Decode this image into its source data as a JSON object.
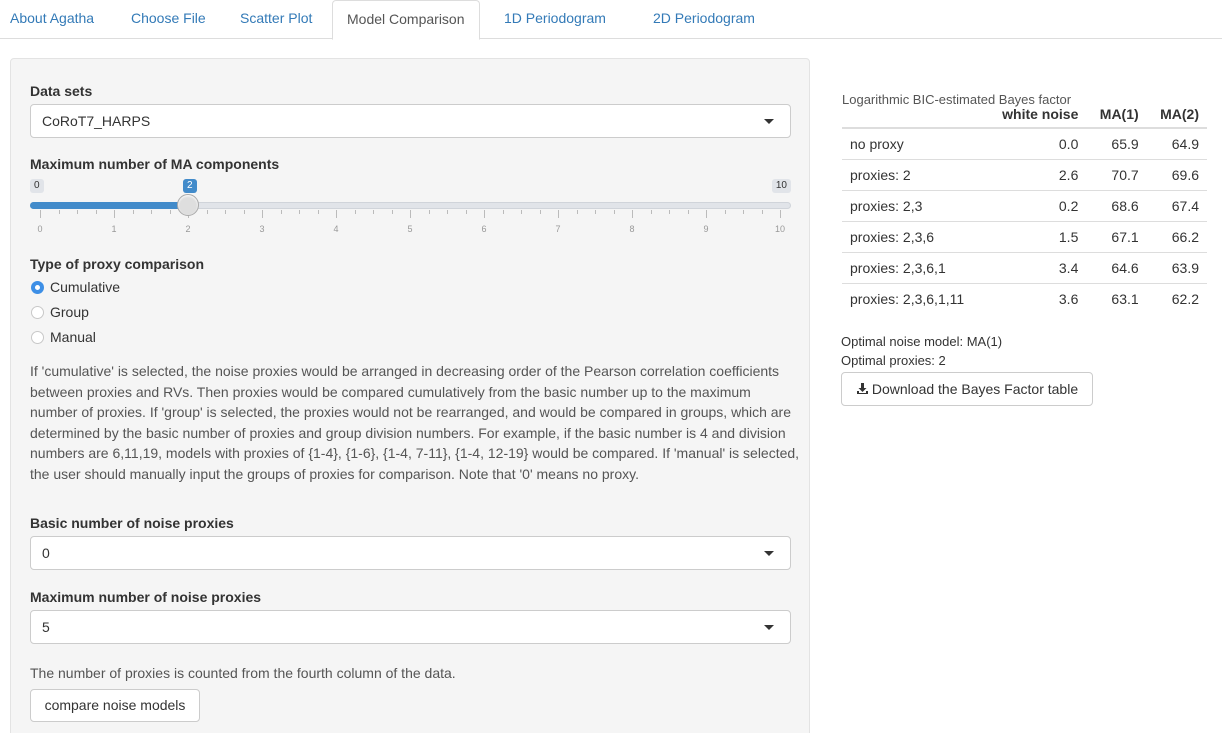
{
  "tabs": [
    "About Agatha",
    "Choose File",
    "Scatter Plot",
    "Model Comparison",
    "1D Periodogram",
    "2D Periodogram"
  ],
  "active_tab": "Model Comparison",
  "datasets": {
    "label": "Data sets",
    "value": "CoRoT7_HARPS"
  },
  "ma_slider": {
    "label": "Maximum number of MA components",
    "min": "0",
    "max": "10",
    "value": "2",
    "value_fraction": 0.2,
    "ticks": [
      "0",
      "1",
      "2",
      "3",
      "4",
      "5",
      "6",
      "7",
      "8",
      "9",
      "10"
    ]
  },
  "proxy_type": {
    "label": "Type of proxy comparison",
    "options": [
      "Cumulative",
      "Group",
      "Manual"
    ],
    "selected": "Cumulative"
  },
  "description": "If 'cumulative' is selected, the noise proxies would be arranged in decreasing order of the Pearson correlation coefficients between proxies and RVs. Then proxies would be compared cumulatively from the basic number up to the maximum number of proxies. If 'group' is selected, the proxies would not be rearranged, and would be compared in groups, which are determined by the basic number of proxies and group division numbers. For example, if the basic number is 4 and division numbers are 6,11,19, models with proxies of {1-4}, {1-6}, {1-4, 7-11}, {1-4, 12-19} would be compared. If 'manual' is selected, the user should manually input the groups of proxies for comparison. Note that '0' means no proxy.",
  "basic_proxies": {
    "label": "Basic number of noise proxies",
    "value": "0"
  },
  "max_proxies": {
    "label": "Maximum number of noise proxies",
    "value": "5"
  },
  "proxy_note": "The number of proxies is counted from the fourth column of the data.",
  "compare_button": "compare noise models",
  "bayes": {
    "title": "Logarithmic BIC-estimated Bayes factor",
    "headers": [
      "",
      "white noise",
      "MA(1)",
      "MA(2)"
    ],
    "rows": [
      [
        "no proxy",
        "0.0",
        "65.9",
        "64.9"
      ],
      [
        "proxies: 2",
        "2.6",
        "70.7",
        "69.6"
      ],
      [
        "proxies: 2,3",
        "0.2",
        "68.6",
        "67.4"
      ],
      [
        "proxies: 2,3,6",
        "1.5",
        "67.1",
        "66.2"
      ],
      [
        "proxies: 2,3,6,1",
        "3.4",
        "64.6",
        "63.9"
      ],
      [
        "proxies: 2,3,6,1,11",
        "3.6",
        "63.1",
        "62.2"
      ]
    ]
  },
  "optimal_model": "Optimal noise model: MA(1)",
  "optimal_proxies": "Optimal proxies: 2",
  "download_button": "Download the Bayes Factor table",
  "download_icon": "download-icon",
  "accent_color": "#428bca"
}
